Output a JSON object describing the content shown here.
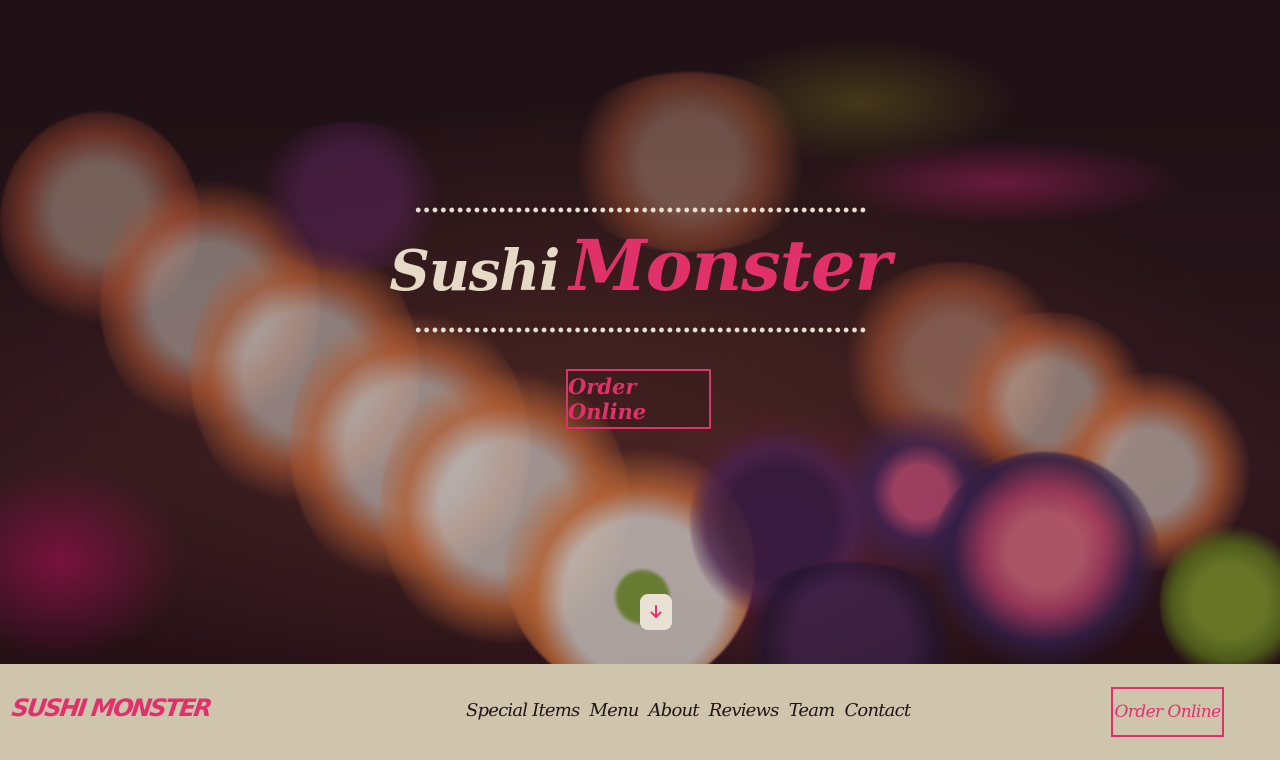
{
  "hero": {
    "title_part1": "Sushi",
    "title_part2": "Monster",
    "order_button_label": "Order Online",
    "scroll_icon": "arrow-down-icon"
  },
  "navbar": {
    "logo_text": "SUSHI MONSTER",
    "links": [
      {
        "label": "Special Items"
      },
      {
        "label": "Menu"
      },
      {
        "label": "About"
      },
      {
        "label": "Reviews"
      },
      {
        "label": "Team"
      },
      {
        "label": "Contact"
      }
    ],
    "order_button_label": "Order Online"
  },
  "colors": {
    "accent": "#e0316a",
    "cream": "#e6dac6",
    "navbar_bg": "#cfc5ad"
  }
}
